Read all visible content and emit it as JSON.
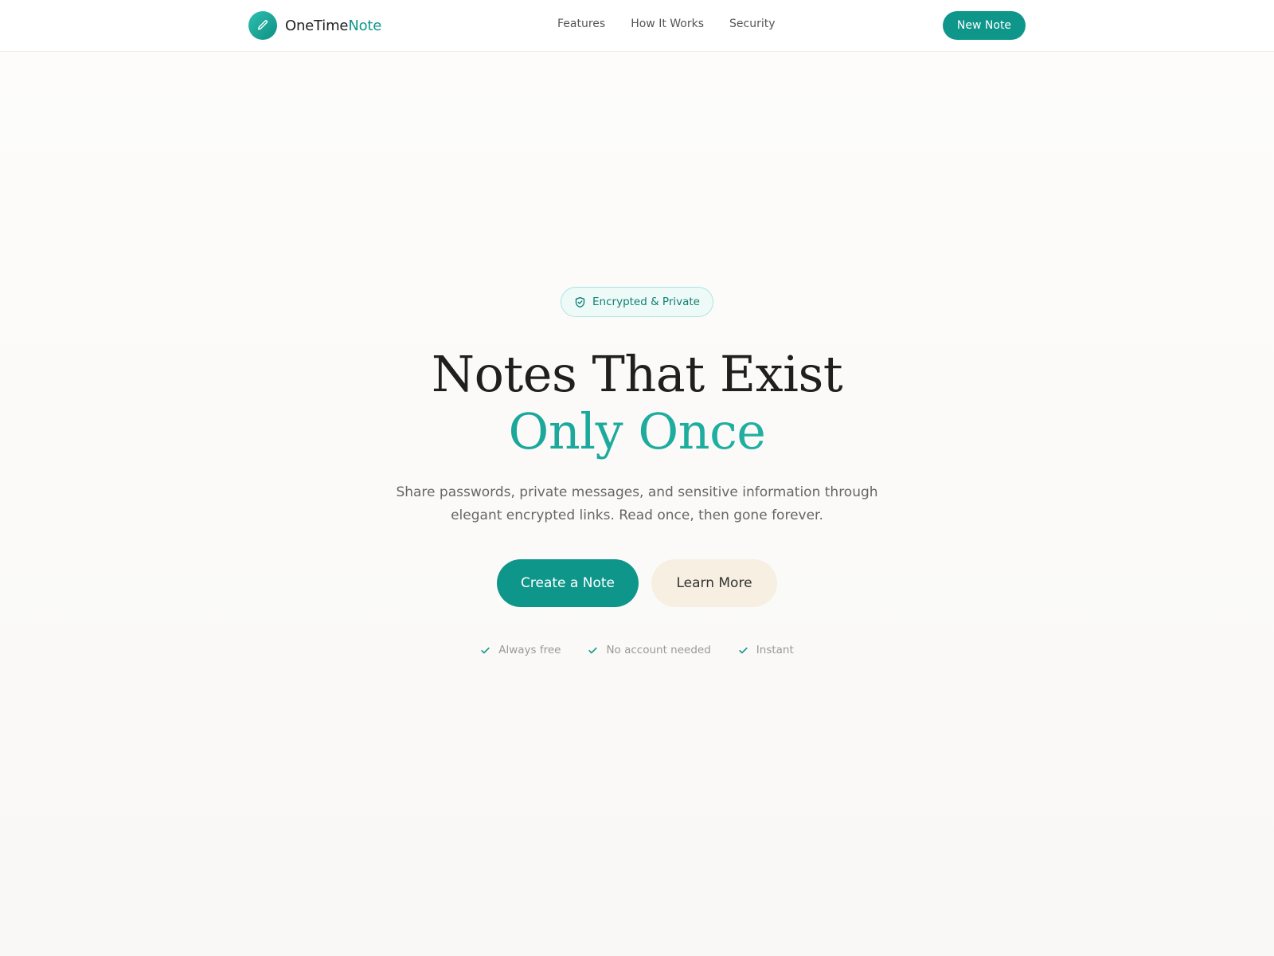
{
  "header": {
    "brand": {
      "name_main": "OneTime",
      "name_accent": "Note",
      "logo_icon": "pencil-icon"
    },
    "nav": [
      {
        "label": "Features"
      },
      {
        "label": "How It Works"
      },
      {
        "label": "Security"
      }
    ],
    "new_note_label": "New Note"
  },
  "hero": {
    "badge": {
      "icon": "shield-check-icon",
      "label": "Encrypted & Private"
    },
    "title_line1": "Notes That Exist",
    "title_line2": "Only Once",
    "subtitle": "Share passwords, private messages, and sensitive information through elegant encrypted links. Read once, then gone forever.",
    "primary_cta": "Create a Note",
    "secondary_cta": "Learn More",
    "perks": [
      {
        "icon": "check-icon",
        "label": "Always free"
      },
      {
        "icon": "check-icon",
        "label": "No account needed"
      },
      {
        "icon": "check-icon",
        "label": "Instant"
      }
    ]
  },
  "colors": {
    "brand": "#0f968a",
    "brand_light": "#2cc0b0",
    "secondary_button_bg": "#f8efe3",
    "badge_bg": "#eefaf8",
    "badge_border": "#a9e6df"
  }
}
